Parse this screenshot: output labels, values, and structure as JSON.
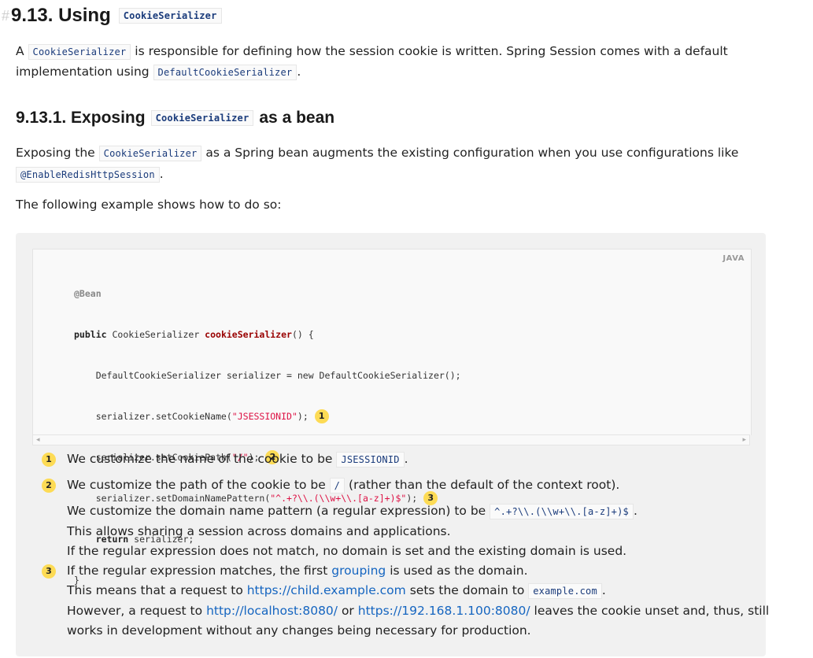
{
  "section": {
    "anchor": "#",
    "title": "9.13. Using",
    "title_code": "CookieSerializer"
  },
  "intro": {
    "a": "A",
    "code1": "CookieSerializer",
    "t1": "is responsible for defining how the session cookie is written. Spring Session comes with a default implementation using",
    "code2": "DefaultCookieSerializer",
    "t2": "."
  },
  "subsection": {
    "title_pre": "9.13.1. Exposing",
    "title_code": "CookieSerializer",
    "title_post": "as a bean"
  },
  "para2": {
    "t1": "Exposing the",
    "code1": "CookieSerializer",
    "t2": "as a Spring bean augments the existing configuration when you use configurations like",
    "code2": "@EnableRedisHttpSession",
    "t3": "."
  },
  "para3": "The following example shows how to do so:",
  "code": {
    "lang": "JAVA",
    "l1": "@Bean",
    "l2_kw": "public",
    "l2_type": " CookieSerializer ",
    "l2_fn": "cookieSerializer",
    "l2_rest": "() {",
    "l3": "    DefaultCookieSerializer serializer = new DefaultCookieSerializer();",
    "l4_a": "    serializer.setCookieName(",
    "l4_s": "\"JSESSIONID\"",
    "l4_b": ");",
    "l5_a": "    serializer.setCookiePath(",
    "l5_s": "\"/\"",
    "l5_b": ");",
    "l6_a": "    serializer.setDomainNamePattern(",
    "l6_s": "\"^.+?\\\\.(\\\\w+\\\\.[a-z]+)$\"",
    "l6_b": ");",
    "l7_kw": "    return",
    "l7_rest": " serializer;",
    "l8": "}",
    "c1": "1",
    "c2": "2",
    "c3": "3"
  },
  "callouts": {
    "one": {
      "num": "1",
      "text": "We customize the name of the cookie to be",
      "code": "JSESSIONID",
      "end": "."
    },
    "two": {
      "num": "2",
      "text": "We customize the path of the cookie to be",
      "code": "/",
      "end": "(rather than the default of the context root)."
    },
    "three": {
      "num": "3",
      "l1": "We customize the domain name pattern (a regular expression) to be",
      "l1_code": "^.+?\\\\.(\\\\w+\\\\.[a-z]+)$",
      "l1_end": ".",
      "l2": "This allows sharing a session across domains and applications.",
      "l3": "If the regular expression does not match, no domain is set and the existing domain is used.",
      "l4_a": "If the regular expression matches, the first",
      "l4_link": "grouping",
      "l4_b": "is used as the domain.",
      "l5_a": "This means that a request to",
      "l5_link": "https://child.example.com",
      "l5_b": "sets the domain to",
      "l5_code": "example.com",
      "l5_end": ".",
      "l6_a": "However, a request to",
      "l6_link1": "http://localhost:8080/",
      "l6_or": "or",
      "l6_link2": "https://192.168.1.100:8080/",
      "l6_b": "leaves the cookie unset and, thus, still",
      "l7": "works in development without any changes being necessary for production."
    }
  },
  "scroll": {
    "left": "◂",
    "right": "▸"
  }
}
